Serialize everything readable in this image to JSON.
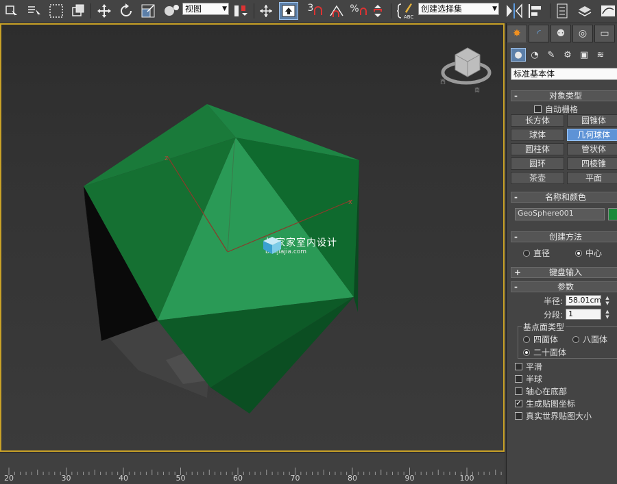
{
  "toolbar": {
    "view_dropdown": "视图",
    "selection_set_dropdown": "创建选择集",
    "snap_3": "3",
    "snap_percent": "%",
    "abc_label": "ABC"
  },
  "viewport": {
    "watermark_title": "扮家家室内设计",
    "watermark_sub": "banjiajia.com",
    "object_color": "#1a7a3c",
    "border_color": "#c9a227"
  },
  "timeline": {
    "ticks": [
      "20",
      "30",
      "40",
      "50",
      "60",
      "70",
      "80",
      "90",
      "100"
    ]
  },
  "panel": {
    "category": "标准基本体",
    "object_type": {
      "title": "对象类型",
      "autogrid": "自动栅格",
      "buttons": [
        {
          "label": "长方体",
          "selected": false
        },
        {
          "label": "圆锥体",
          "selected": false
        },
        {
          "label": "球体",
          "selected": false
        },
        {
          "label": "几何球体",
          "selected": true
        },
        {
          "label": "圆柱体",
          "selected": false
        },
        {
          "label": "管状体",
          "selected": false
        },
        {
          "label": "圆环",
          "selected": false
        },
        {
          "label": "四棱锥",
          "selected": false
        },
        {
          "label": "茶壶",
          "selected": false
        },
        {
          "label": "平面",
          "selected": false
        }
      ]
    },
    "name_color": {
      "title": "名称和颜色",
      "name": "GeoSphere001",
      "swatch": "#1a8a3a"
    },
    "creation_method": {
      "title": "创建方法",
      "options": [
        "直径",
        "中心"
      ],
      "selected": "中心"
    },
    "keyboard_entry": {
      "title": "键盘输入"
    },
    "parameters": {
      "title": "参数",
      "radius_label": "半径:",
      "radius_value": "58.01cm",
      "segments_label": "分段:",
      "segments_value": "1",
      "base_type_title": "基点面类型",
      "base_types": [
        "四面体",
        "八面体",
        "二十面体"
      ],
      "base_type_selected": "二十面体",
      "checkboxes": [
        {
          "label": "平滑",
          "checked": false
        },
        {
          "label": "半球",
          "checked": false
        },
        {
          "label": "轴心在底部",
          "checked": false
        },
        {
          "label": "生成贴图坐标",
          "checked": true
        },
        {
          "label": "真实世界贴图大小",
          "checked": false
        }
      ]
    }
  }
}
